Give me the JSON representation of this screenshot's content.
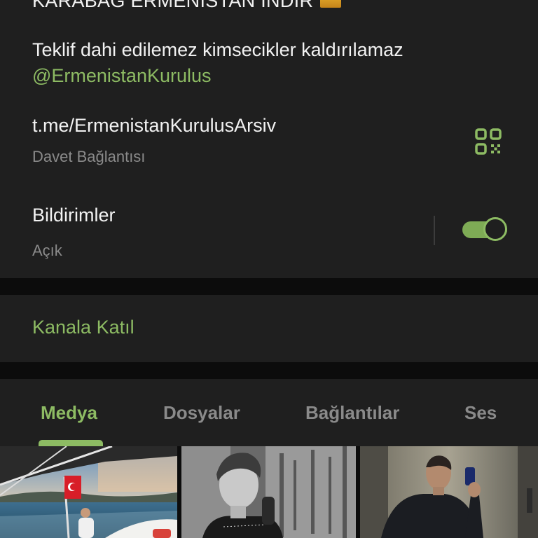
{
  "channel": {
    "description_top_partial": "KARABAĞ ERMENİSTAN İNDİR",
    "description": "Teklif dahi edilemez kimsecikler kaldırılamaz",
    "mention": "@ErmenistanKurulus"
  },
  "invite": {
    "link": "t.me/ErmenistanKurulusArsiv",
    "label": "Davet Bağlantısı",
    "icon": "qr-code-icon"
  },
  "notifications": {
    "title": "Bildirimler",
    "status": "Açık",
    "enabled": true
  },
  "join": {
    "label": "Kanala Katıl"
  },
  "tabs": [
    {
      "label": "Medya",
      "active": true
    },
    {
      "label": "Dosyalar",
      "active": false
    },
    {
      "label": "Bağlantılar",
      "active": false
    },
    {
      "label": "Ses",
      "active": false
    }
  ],
  "colors": {
    "accent": "#8dbb63",
    "background": "#1f1f1f",
    "secondary_text": "#8a8a8a"
  },
  "media": [
    {
      "subject": "boat-with-turkish-flag"
    },
    {
      "subject": "portrait-black-and-white"
    },
    {
      "subject": "elevator-mirror-selfie"
    }
  ]
}
